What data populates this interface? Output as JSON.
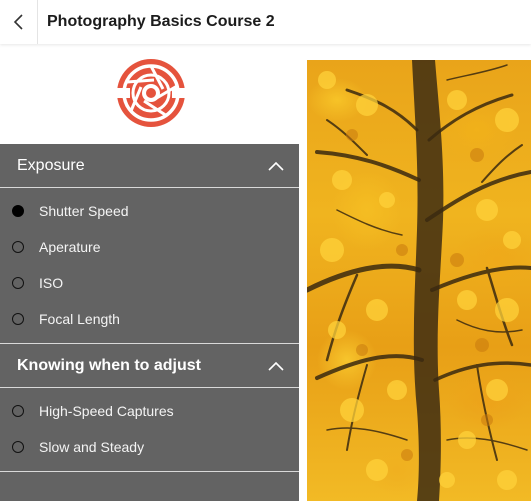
{
  "header": {
    "title": "Photography Basics Course 2",
    "back_icon": "chevron-left-icon"
  },
  "logo": {
    "icon": "camera-aperture-logo-icon",
    "color": "#e5533d"
  },
  "sections": [
    {
      "title": "Exposure",
      "expanded": true,
      "items": [
        {
          "label": "Shutter Speed",
          "selected": true
        },
        {
          "label": "Aperature",
          "selected": false
        },
        {
          "label": "ISO",
          "selected": false
        },
        {
          "label": "Focal Length",
          "selected": false
        }
      ]
    },
    {
      "title": "Knowing when to adjust",
      "expanded": true,
      "items": [
        {
          "label": "High-Speed Captures",
          "selected": false
        },
        {
          "label": "Slow and Steady",
          "selected": false
        }
      ]
    }
  ],
  "colors": {
    "sidebar_bg": "#636363",
    "accent": "#e5533d",
    "header_text": "#1c1c1c"
  }
}
